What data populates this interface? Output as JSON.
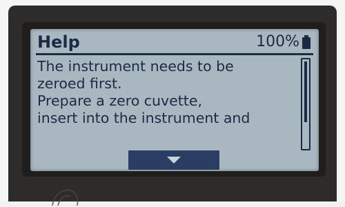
{
  "screen": {
    "title": "Help",
    "battery_percent": "100%",
    "battery_icon": "battery-full-icon",
    "message_lines": [
      "The instrument needs to be",
      "zeroed first.",
      "Prepare a zero cuvette,",
      "insert into the instrument and"
    ],
    "scroll_down_icon": "triangle-down-icon"
  },
  "colors": {
    "lcd_background": "#a9b7c1",
    "lcd_text": "#1d2a44",
    "button_fill": "#2b3d63",
    "device_body": "#2e2c2b"
  }
}
